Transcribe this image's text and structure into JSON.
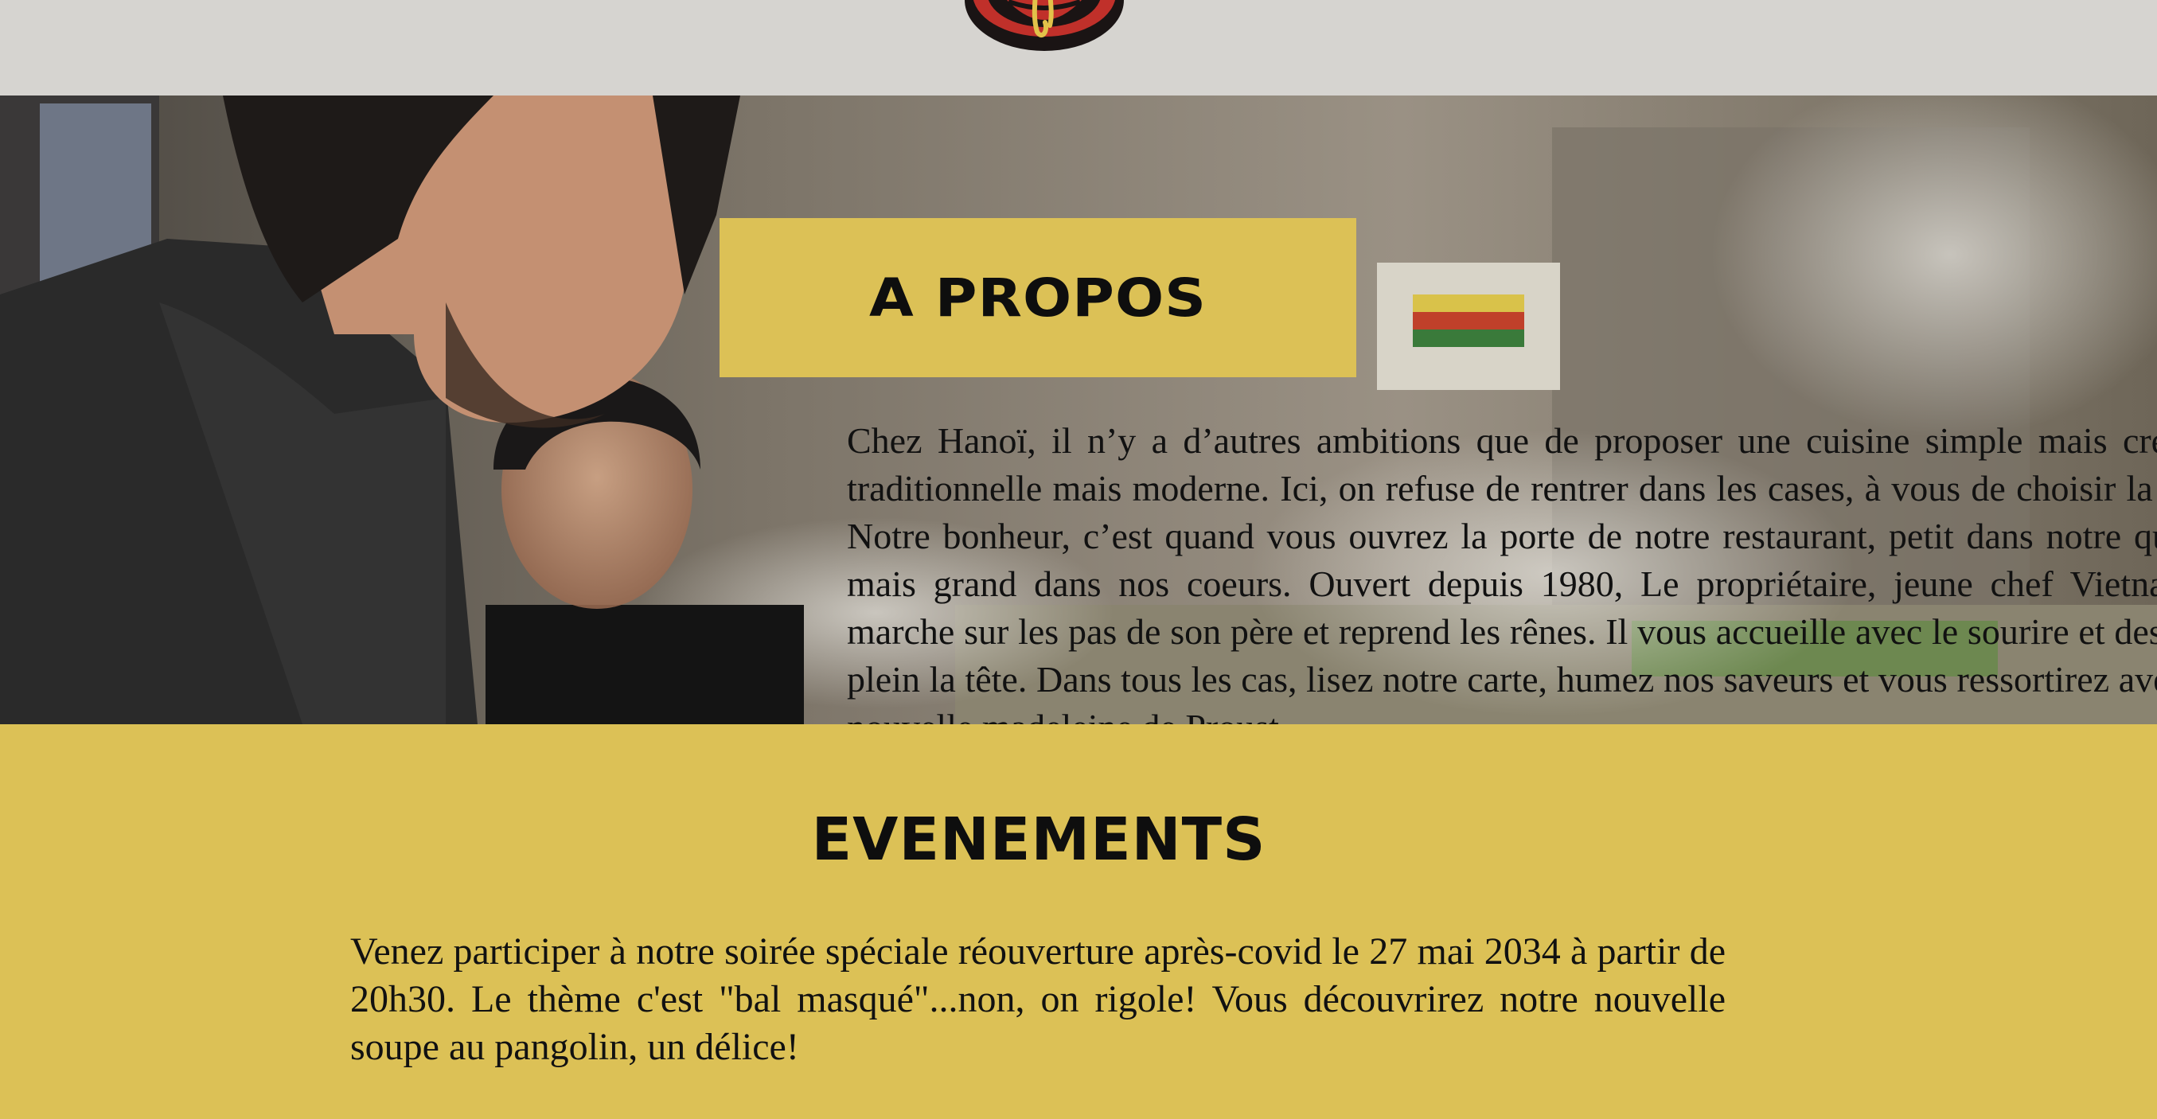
{
  "header": {
    "logo_icon": "bowl-logo-icon"
  },
  "about": {
    "title": "A PROPOS",
    "body": "Chez Hanoï, il n’y a d’autres ambitions que de proposer une cuisine simple mais créative, traditionnelle mais moderne. Ici, on refuse de rentrer dans les cases, à vous de choisir la vôtre. Notre bonheur, c’est quand vous ouvrez la porte de notre restaurant, petit dans notre quartier mais grand dans nos coeurs. Ouvert depuis 1980, Le propriétaire, jeune chef Vietnamien, marche sur les pas de son père et reprend les rênes. Il vous accueille avec le sourire et des idées plein la tête. Dans tous les cas, lisez notre carte, humez nos saveurs et vous ressortirez avec une nouvelle madeleine de Proust.",
    "background_image": "kitchen-photo"
  },
  "events": {
    "title": "EVENEMENTS",
    "body": "Venez participer à notre soirée spéciale réouverture après-covid le 27 mai 2034 à partir de 20h30. Le thème c'est \"bal masqué\"...non, on rigole! Vous découvrirez notre nouvelle soupe au pangolin, un délice!"
  },
  "colors": {
    "accent_yellow": "#dcc156",
    "header_gray": "#d6d4d0",
    "text_dark": "#111111"
  }
}
